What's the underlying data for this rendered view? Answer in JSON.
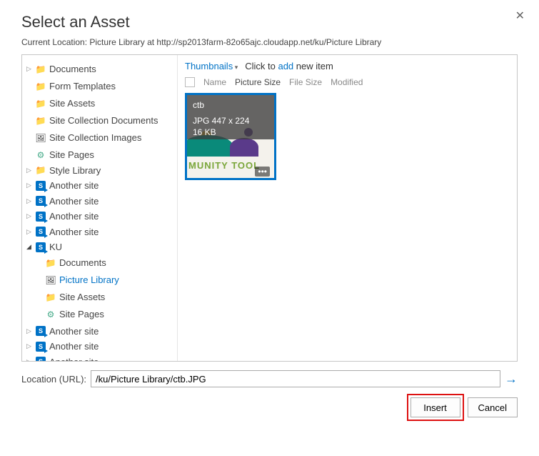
{
  "dialog": {
    "title": "Select an Asset",
    "close": "✕",
    "location_label": "Current Location: ",
    "location_value": "Picture Library at http://sp2013farm-82o65ajc.cloudapp.net/ku/Picture Library"
  },
  "tree": {
    "items": [
      {
        "icon": "folder",
        "label": "Documents",
        "twist": "closed"
      },
      {
        "icon": "folder",
        "label": "Form Templates"
      },
      {
        "icon": "folder",
        "label": "Site Assets"
      },
      {
        "icon": "folder",
        "label": "Site Collection Documents"
      },
      {
        "icon": "img",
        "label": "Site Collection Images"
      },
      {
        "icon": "gear",
        "label": "Site Pages"
      },
      {
        "icon": "folder",
        "label": "Style Library",
        "twist": "closed"
      },
      {
        "icon": "sp",
        "label": "Another site",
        "twist": "closed"
      },
      {
        "icon": "sp",
        "label": "Another site",
        "twist": "closed"
      },
      {
        "icon": "sp",
        "label": "Another site",
        "twist": "closed"
      },
      {
        "icon": "sp",
        "label": "Another site",
        "twist": "closed"
      },
      {
        "icon": "sp",
        "label": "KU",
        "twist": "open",
        "children": [
          {
            "icon": "folder",
            "label": "Documents"
          },
          {
            "icon": "img",
            "label": "Picture Library",
            "selected": true
          },
          {
            "icon": "folder",
            "label": "Site Assets"
          },
          {
            "icon": "gear",
            "label": "Site Pages"
          }
        ]
      },
      {
        "icon": "sp",
        "label": "Another site",
        "twist": "closed"
      },
      {
        "icon": "sp",
        "label": "Another site",
        "twist": "closed"
      },
      {
        "icon": "sp",
        "label": "Another site",
        "twist": "closed"
      }
    ]
  },
  "content": {
    "view_label": "Thumbnails",
    "click_to": "Click to ",
    "add": "add",
    "new_item": " new item",
    "columns": [
      "Name",
      "Picture Size",
      "File Size",
      "Modified"
    ],
    "active_col": "Picture Size",
    "tile": {
      "name": "ctb",
      "type_dims": "JPG 447 x 224",
      "size": "16 KB",
      "band": "MUNITY TOOL"
    }
  },
  "footer": {
    "url_label": "Location (URL):",
    "url_value": "/ku/Picture Library/ctb.JPG",
    "insert": "Insert",
    "cancel": "Cancel"
  }
}
